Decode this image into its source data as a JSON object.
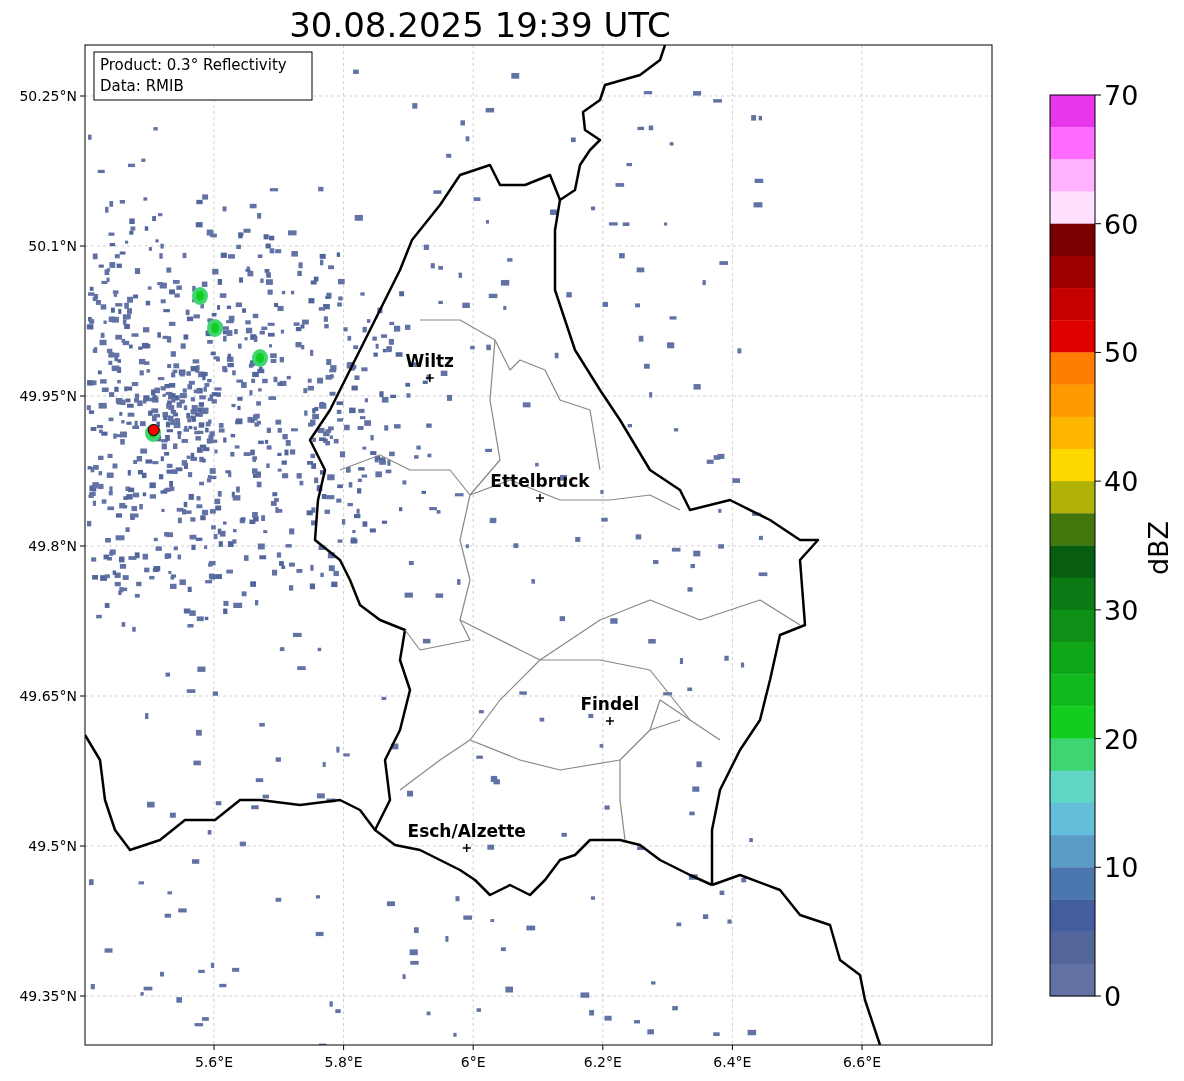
{
  "title": "30.08.2025 19:39 UTC",
  "info_box": [
    "Product: 0.3° Reflectivity",
    "Data: RMIB"
  ],
  "map": {
    "y_ticks": [
      "50.25°N",
      "50.1°N",
      "49.95°N",
      "49.8°N",
      "49.65°N",
      "49.5°N",
      "49.35°N"
    ],
    "x_ticks": [
      "5.6°E",
      "5.8°E",
      "6°E",
      "6.2°E",
      "6.4°E",
      "6.6°E"
    ],
    "cities": [
      "Wiltz",
      "Ettelbruck",
      "Findel",
      "Esch/Alzette"
    ]
  },
  "colorbar": {
    "ticks": [
      "70",
      "60",
      "50",
      "40",
      "30",
      "20",
      "10",
      "0"
    ],
    "label": "dBZ",
    "bins": [
      {
        "color": "#e936ed"
      },
      {
        "color": "#ff6cff"
      },
      {
        "color": "#ffb2ff"
      },
      {
        "color": "#ffe0ff"
      },
      {
        "color": "#780000"
      },
      {
        "color": "#9e0000"
      },
      {
        "color": "#c40000"
      },
      {
        "color": "#e00000"
      },
      {
        "color": "#ff7e00"
      },
      {
        "color": "#ff9a00"
      },
      {
        "color": "#ffb600"
      },
      {
        "color": "#ffd800"
      },
      {
        "color": "#b0b206"
      },
      {
        "color": "#44760e"
      },
      {
        "color": "#075e10"
      },
      {
        "color": "#0b7a14"
      },
      {
        "color": "#0e9016"
      },
      {
        "color": "#0fa618"
      },
      {
        "color": "#10ba1c"
      },
      {
        "color": "#12cc1e"
      },
      {
        "color": "#3ed670"
      },
      {
        "color": "#60d6c6"
      },
      {
        "color": "#62bedb"
      },
      {
        "color": "#5b9cc6"
      },
      {
        "color": "#4a78ae"
      },
      {
        "color": "#435e9e"
      },
      {
        "color": "#52669c"
      },
      {
        "color": "#6272a4"
      }
    ]
  }
}
